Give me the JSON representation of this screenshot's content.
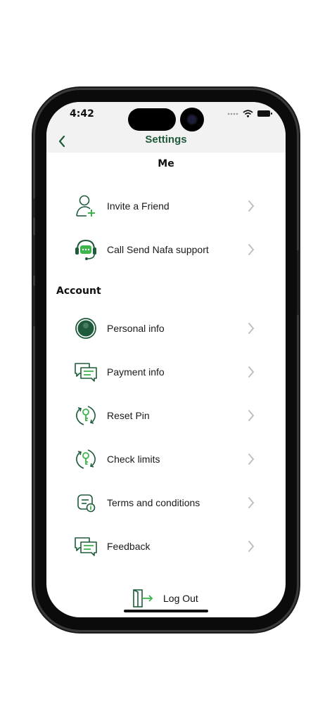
{
  "status_bar": {
    "time": "4:42"
  },
  "header": {
    "title": "Settings"
  },
  "sections": {
    "me": "Me",
    "account": "Account"
  },
  "me_items": [
    {
      "label": "Invite a Friend",
      "icon": "add-user-icon"
    },
    {
      "label": "Call Send Nafa support",
      "icon": "support-headset-icon"
    }
  ],
  "account_items": [
    {
      "label": "Personal info",
      "icon": "user-avatar-icon"
    },
    {
      "label": "Payment info",
      "icon": "chat-bubbles-icon"
    },
    {
      "label": "Reset Pin",
      "icon": "key-refresh-icon"
    },
    {
      "label": "Check limits",
      "icon": "key-refresh-icon"
    },
    {
      "label": "Terms and conditions",
      "icon": "document-info-icon"
    },
    {
      "label": "Feedback",
      "icon": "chat-bubbles-icon"
    }
  ],
  "logout": {
    "label": "Log Out",
    "icon": "exit-door-icon"
  },
  "colors": {
    "brand_dark": "#1f5b3b",
    "brand_light": "#3cb54a",
    "chevron": "#b8bcc2",
    "header_bg": "#f2f2f2"
  }
}
